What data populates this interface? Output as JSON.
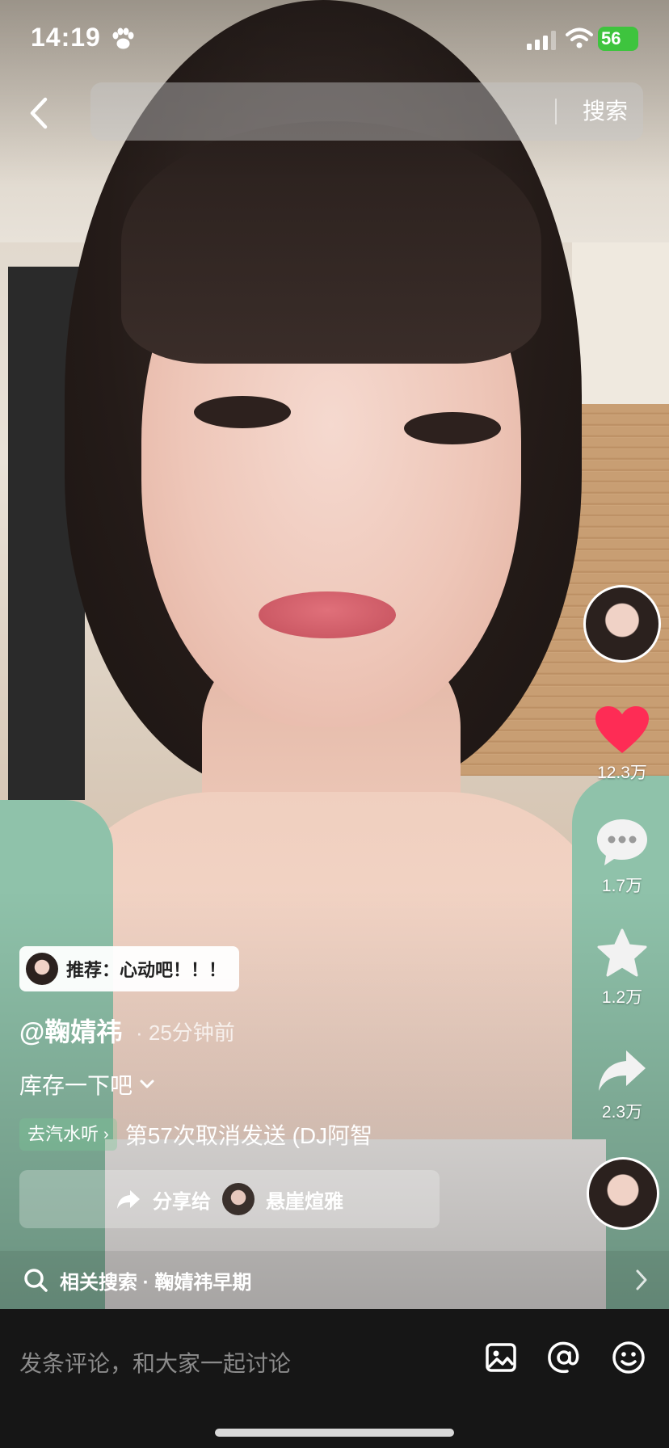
{
  "status_bar": {
    "time": "14:19",
    "battery": "56"
  },
  "top_bar": {
    "search_placeholder": "",
    "search_button": "搜索"
  },
  "right_rail": {
    "likes": "12.3万",
    "comments": "1.7万",
    "favorites": "1.2万",
    "shares": "2.3万"
  },
  "video_info": {
    "recommend": "推荐：心动吧！！！",
    "author": "@鞠婧祎",
    "time_ago": "· 25分钟前",
    "caption": "库存一下吧",
    "music_tag": "去汽水听",
    "music_name": "第57次取消发送 (DJ阿智"
  },
  "share_bar": {
    "label": "分享给",
    "target_name": "悬崖煊雅"
  },
  "related_search": {
    "text": "相关搜索 · 鞠婧祎早期"
  },
  "comment_bar": {
    "placeholder": "发条评论，和大家一起讨论"
  },
  "colors": {
    "like_red": "#fe2c55",
    "battery_green": "#3ec43e",
    "comment_bar_bg": "#161616"
  },
  "icons": [
    "back-chevron-icon",
    "paw-icon",
    "signal-icon",
    "wifi-icon",
    "heart-icon",
    "comment-bubble-icon",
    "star-icon",
    "share-arrow-icon",
    "chevron-down-icon",
    "search-icon",
    "chevron-right-icon",
    "image-icon",
    "at-icon",
    "emoji-icon"
  ]
}
